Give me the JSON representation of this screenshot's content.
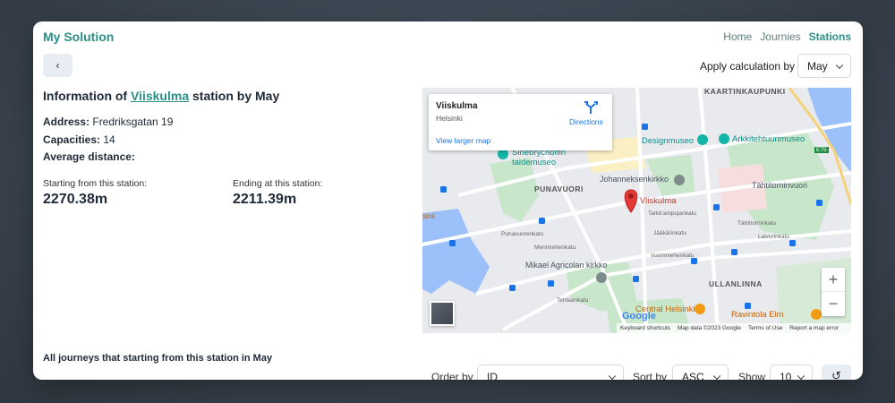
{
  "header": {
    "brand": "My Solution",
    "nav": [
      {
        "label": "Home",
        "active": false
      },
      {
        "label": "Journies",
        "active": false
      },
      {
        "label": "Stations",
        "active": true
      }
    ]
  },
  "toolbar": {
    "back_label": "‹",
    "apply_calc_label": "Apply calculation by",
    "month_value": "May"
  },
  "station": {
    "title_prefix": "Information of ",
    "name": "Viiskulma",
    "title_suffix": " station by May",
    "address_label": "Address:",
    "address_value": "Fredriksgatan 19",
    "capacities_label": "Capacities:",
    "capacities_value": "14",
    "avg_distance_label": "Average distance:",
    "starting_label": "Starting from this station:",
    "starting_value": "2270.38m",
    "ending_label": "Ending at this station:",
    "ending_value": "2211.39m"
  },
  "map": {
    "card_name": "Viiskulma",
    "card_city": "Helsinki",
    "directions": "Directions",
    "view_larger": "View larger map",
    "zoom_in": "+",
    "zoom_out": "−",
    "google": "Google",
    "footer": [
      "Keyboard shortcuts",
      "Map data ©2023 Google",
      "Terms of Use",
      "Report a map error"
    ],
    "labels": {
      "kaartinkaupunki": "KAARTINKAUPUNKI",
      "punavuori": "PUNAVUORI",
      "ullanlinna": "ULLANLINNA",
      "sinebrychoff": "Sinebrychoffin",
      "taidemuseo": "taidemuseo",
      "designmuseo": "Designmuseo",
      "arkkitehtuurimuseo": "Arkkitehtuurimuseo",
      "johanneksenkirkko": "Johanneksenkirkko",
      "viiskulma": "Viiskulma",
      "tahtitorninvuori": "Tähtitorninvuori",
      "agricola": "Mikael Agricolan kirkko",
      "central_helsinki": "Central Helsinki",
      "ravintola": "Ravintola Elm",
      "punavuorenkatu": "Punavuorenkatu",
      "merimiehenkatu": "Merimiehenkatu",
      "tarkk_ampujankatu": "Tarkk'ampujankatu",
      "jaakarinkatu": "Jääkärinkatu",
      "laivurinkatu": "Laivurinkatu",
      "vuorimiehenkatu": "Vuorimiehenkatu",
      "tehtaankatu": "Tehtaankatu",
      "tahtitorninkatu": "Tähtitorninkatu",
      "e75": "E75",
      "sinii": "sinii"
    }
  },
  "journeys": {
    "title": "All journeys that starting from this station in May",
    "order_by_label": "Order by",
    "order_by_value": "ID",
    "sort_by_label": "Sort by",
    "sort_by_value": "ASC",
    "show_label": "Show",
    "show_value": "10",
    "reset_icon": "↺"
  },
  "colors": {
    "brand": "#2a8f86",
    "marker": "#e53935",
    "park": "#c8e6c9",
    "water": "#9cc0f9"
  }
}
